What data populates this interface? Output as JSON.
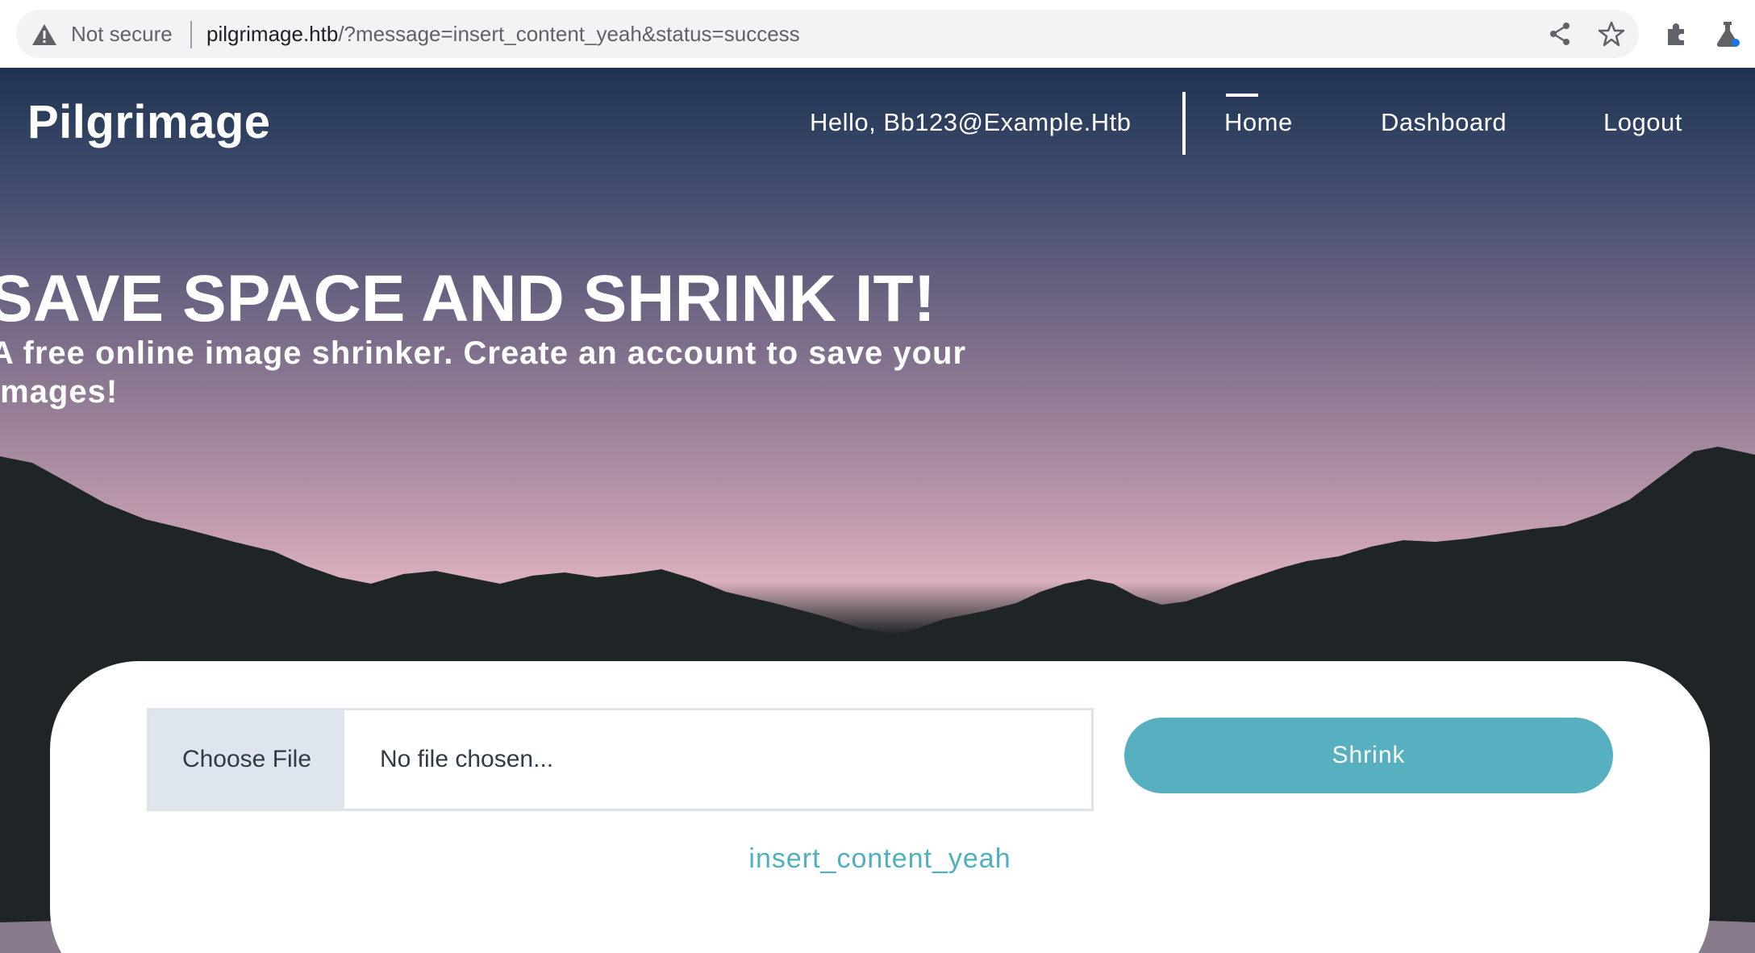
{
  "browser": {
    "security_label": "Not secure",
    "url_host": "pilgrimage.htb",
    "url_rest": "/?message=insert_content_yeah&status=success",
    "icons": [
      "warning-icon",
      "share-icon",
      "star-icon",
      "extensions-icon",
      "labs-icon"
    ]
  },
  "nav": {
    "brand": "Pilgrimage",
    "greeting": "Hello, Bb123@Example.Htb",
    "links": [
      "Home",
      "Dashboard",
      "Logout"
    ],
    "active": "Home"
  },
  "hero": {
    "title": "SAVE SPACE AND SHRINK IT!",
    "subtitle": "A free online image shrinker. Create an account to save your images!"
  },
  "upload": {
    "choose_label": "Choose File",
    "file_placeholder": "No file chosen...",
    "submit_label": "Shrink",
    "message": "insert_content_yeah"
  },
  "colors": {
    "accent": "#56b0bf",
    "message": "#4fb0c0",
    "mountains": "#1f2527"
  }
}
